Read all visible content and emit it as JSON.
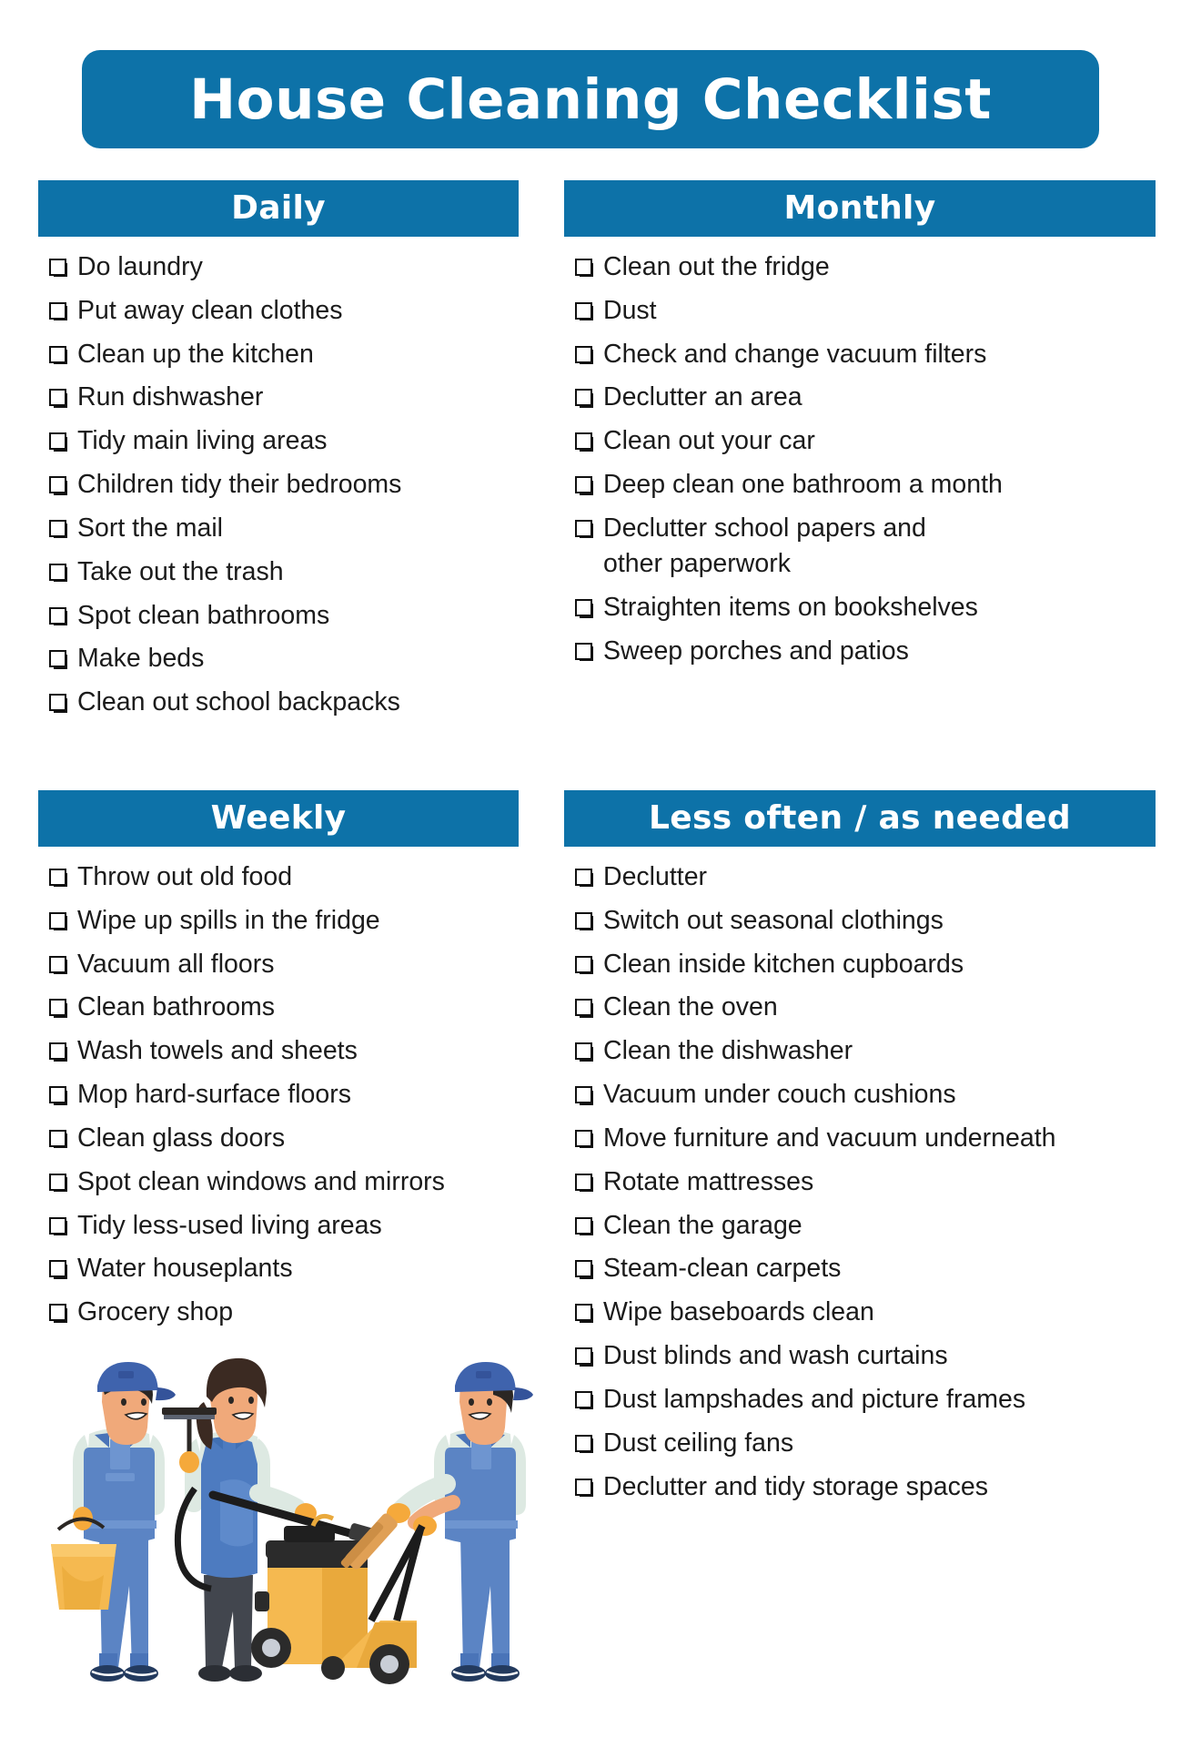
{
  "document": {
    "title": "House Cleaning Checklist",
    "accent_color": "#0D72A8",
    "text_color": "#1b1b1b",
    "background_color": "#ffffff",
    "checkbox_glyph": "empty-square"
  },
  "sections": {
    "daily": {
      "heading": "Daily",
      "items": [
        "Do laundry",
        "Put away clean clothes",
        "Clean up the kitchen",
        "Run dishwasher",
        "Tidy main living areas",
        "Children tidy their bedrooms",
        "Sort the mail",
        "Take out the trash",
        "Spot clean bathrooms",
        "Make beds",
        "Clean out school backpacks"
      ]
    },
    "monthly": {
      "heading": "Monthly",
      "items": [
        "Clean out the fridge",
        "Dust",
        "Check and change vacuum filters",
        "Declutter an area",
        "Clean out your car",
        "Deep clean one bathroom a month",
        "Declutter school papers and other paperwork",
        "Straighten items on bookshelves",
        "Sweep porches and patios"
      ]
    },
    "weekly": {
      "heading": "Weekly",
      "items": [
        "Throw out old food",
        "Wipe up spills in the fridge",
        "Vacuum all floors",
        "Clean bathrooms",
        "Wash towels and sheets",
        "Mop hard-surface floors",
        "Clean glass doors",
        "Spot clean windows and mirrors",
        "Tidy less-used living areas",
        "Water houseplants",
        "Grocery shop"
      ]
    },
    "less_often": {
      "heading": "Less often / as needed",
      "items": [
        "Declutter",
        "Switch out seasonal clothings",
        "Clean inside kitchen cupboards",
        "Clean the oven",
        "Clean the dishwasher",
        "Vacuum under couch cushions",
        "Move furniture and vacuum underneath",
        "Rotate mattresses",
        "Clean the garage",
        "Steam-clean carpets",
        "Wipe baseboards clean",
        "Dust blinds and wash curtains",
        "Dust lampshades and picture frames",
        "Dust ceiling fans",
        "Declutter and tidy storage spaces"
      ]
    }
  },
  "illustration": {
    "name": "cleaning-crew-illustration",
    "description": "Three cleaning workers in blue overalls with bucket, squeegee, yellow vacuum and floor scrubber"
  }
}
